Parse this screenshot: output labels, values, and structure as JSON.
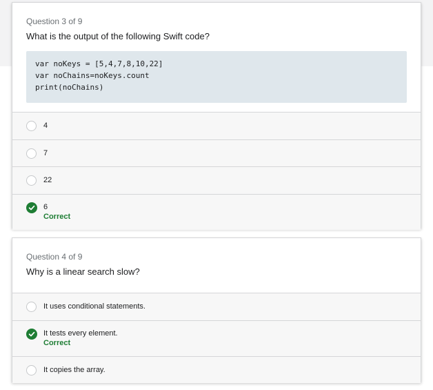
{
  "questions": [
    {
      "counter": "Question 3 of 9",
      "prompt": "What is the output of the following Swift code?",
      "code": [
        "var noKeys = [5,4,7,8,10,22]",
        "var noChains=noKeys.count",
        "print(noChains)"
      ],
      "options": [
        {
          "label": "4",
          "state": "unselected"
        },
        {
          "label": "7",
          "state": "unselected"
        },
        {
          "label": "22",
          "state": "unselected"
        },
        {
          "label": "6",
          "state": "correct",
          "feedback": "Correct"
        }
      ]
    },
    {
      "counter": "Question 4 of 9",
      "prompt": "Why is a linear search slow?",
      "options": [
        {
          "label": "It uses conditional statements.",
          "state": "unselected"
        },
        {
          "label": "It tests every element.",
          "state": "correct",
          "feedback": "Correct"
        },
        {
          "label": "It copies the array.",
          "state": "unselected"
        }
      ]
    }
  ],
  "colors": {
    "correct": "#1e7d34",
    "code_bg": "#dfe7ec",
    "option_bg": "#f7f7f7"
  },
  "icons": {
    "correct": "check-circle-icon",
    "unselected": "radio-empty-icon"
  }
}
